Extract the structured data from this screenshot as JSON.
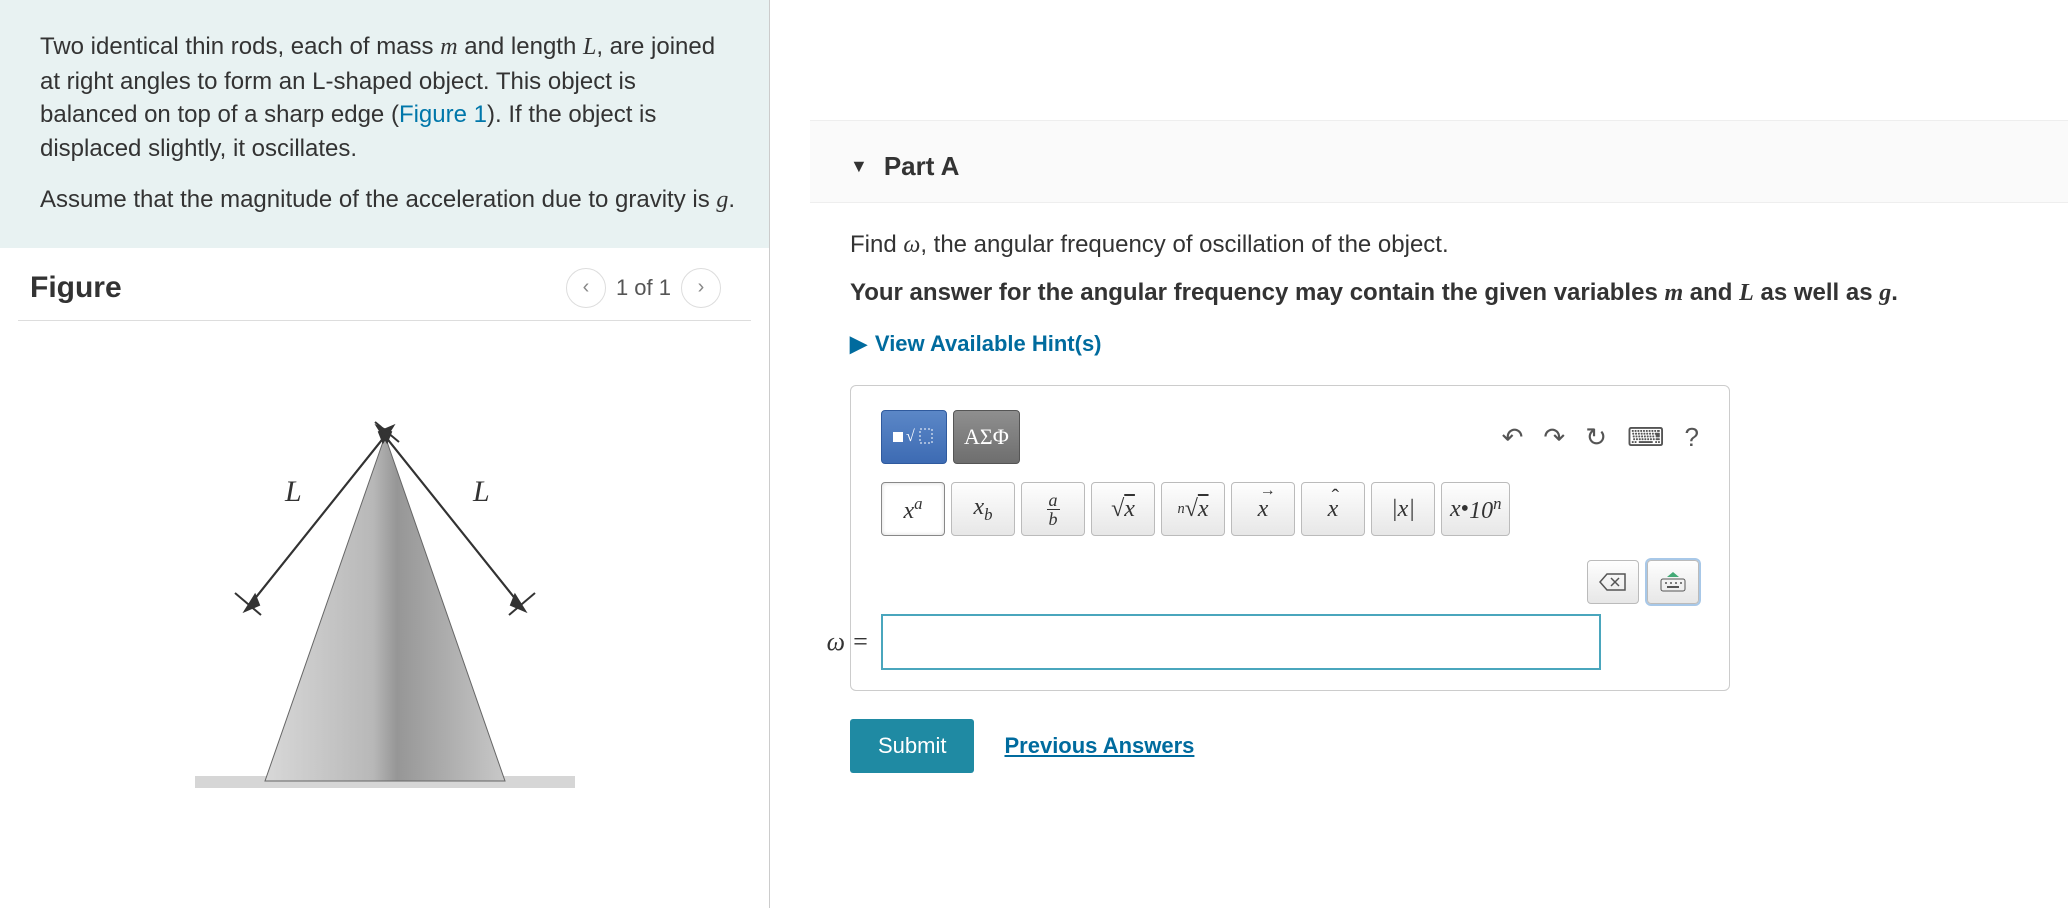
{
  "prompt": {
    "p1_a": "Two identical thin rods, each of mass ",
    "p1_b": " and length ",
    "p1_c": ", are joined at right angles to form an L-shaped object. This object is balanced on top of a sharp edge (",
    "p1_link": "Figure 1",
    "p1_d": "). If the object is displaced slightly, it oscillates.",
    "p2_a": "Assume that the magnitude of the acceleration due to gravity is ",
    "p2_b": ".",
    "var_m": "m",
    "var_L": "L",
    "var_g": "g"
  },
  "figure": {
    "title": "Figure",
    "prev_icon": "‹",
    "counter": "1 of 1",
    "next_icon": "›",
    "rod_label_left": "L",
    "rod_label_right": "L"
  },
  "part": {
    "caret": "▼",
    "title": "Part A",
    "instruction_a": "Find ",
    "instruction_var": "ω",
    "instruction_b": ", the angular frequency of oscillation of the object.",
    "hint_text_a": "Your answer for the angular frequency may contain the given variables ",
    "hint_text_b": " and ",
    "hint_text_c": " as well as ",
    "hint_text_d": ".",
    "hints_caret": "▶",
    "hints_link": "View Available Hint(s)"
  },
  "toolbar": {
    "math_mode": "■ √☐",
    "greek_mode": "ΑΣΦ",
    "undo": "↶",
    "redo": "↷",
    "reset": "↻",
    "keyboard": "⌨",
    "help": "?"
  },
  "templates": {
    "sup": "xᵃ",
    "sub": "x_b",
    "frac_a": "a",
    "frac_b": "b",
    "sqrt": "√x",
    "nroot": "ⁿ√x",
    "vec": "x",
    "hat": "x",
    "abs": "|x|",
    "sci": "x·10ⁿ"
  },
  "ghost": {
    "backspace": "⌫",
    "kbd": "⌨"
  },
  "answer": {
    "label": "ω =",
    "value": ""
  },
  "actions": {
    "submit": "Submit",
    "previous": "Previous Answers"
  }
}
